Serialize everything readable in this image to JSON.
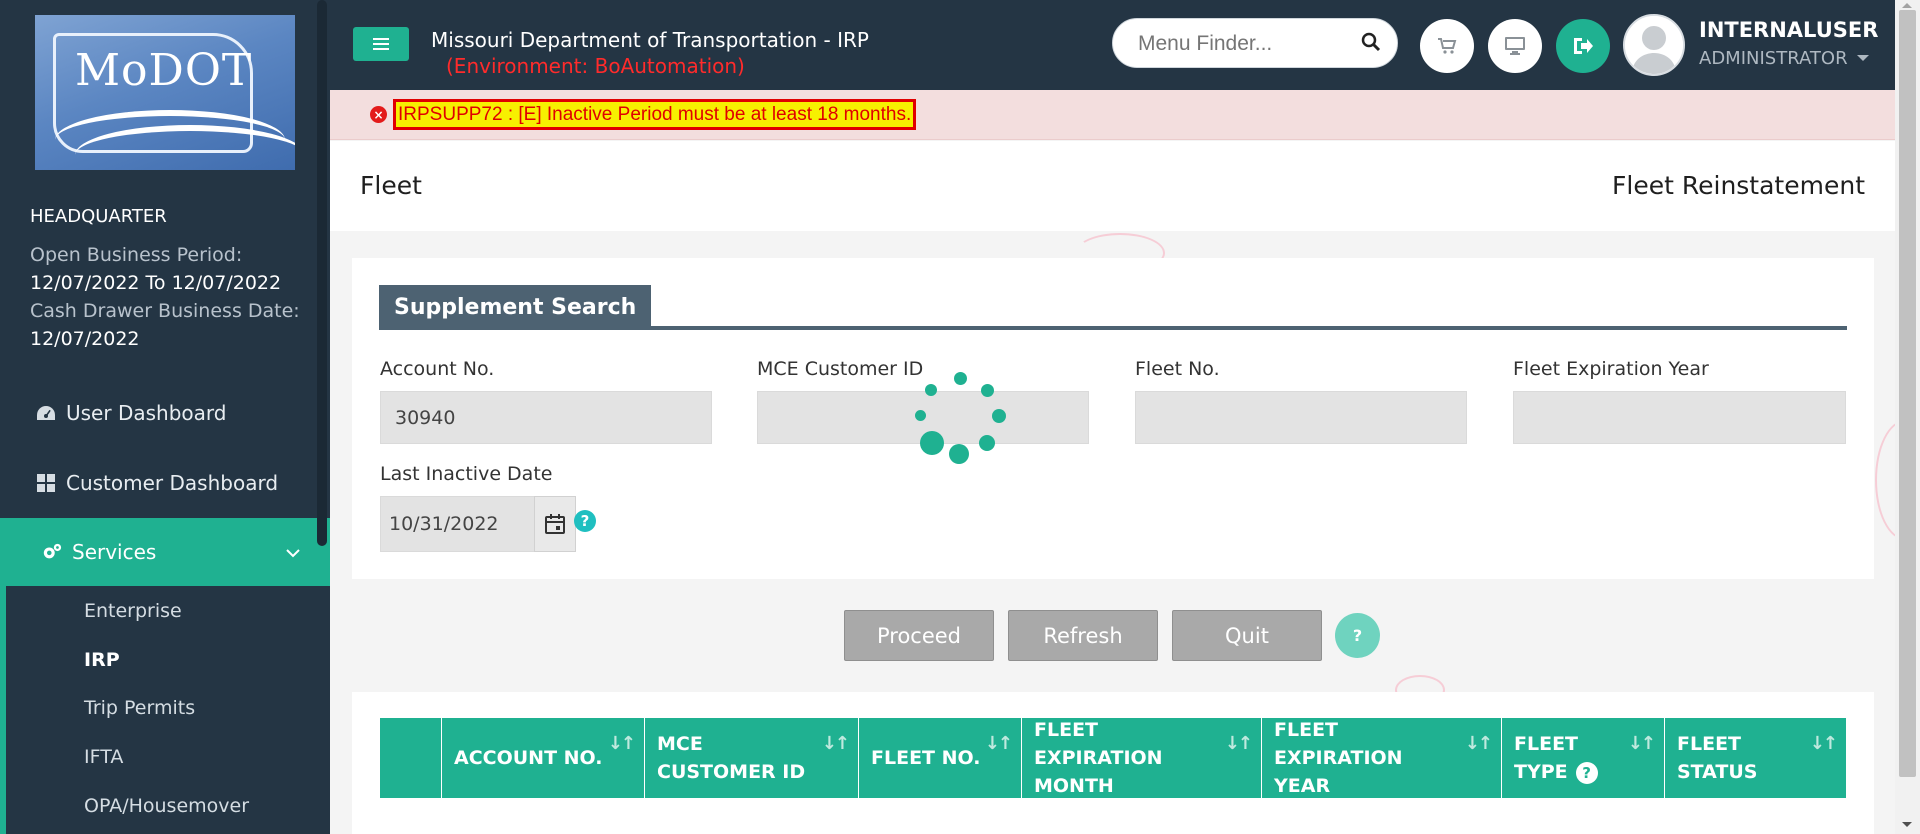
{
  "sidebar": {
    "logo_text": "MoDOT",
    "location": "HEADQUARTER",
    "open_period_label": "Open Business Period:",
    "open_period_value": "12/07/2022 To 12/07/2022",
    "cash_drawer_label": "Cash Drawer Business Date:",
    "cash_drawer_value": "12/07/2022",
    "nav": [
      {
        "label": "User Dashboard",
        "icon": "dashboard-icon"
      },
      {
        "label": "Customer Dashboard",
        "icon": "grid-icon"
      },
      {
        "label": "Services",
        "icon": "gears-icon"
      }
    ],
    "sub_items": [
      "Enterprise",
      "IRP",
      "Trip Permits",
      "IFTA",
      "OPA/Housemover"
    ]
  },
  "header": {
    "title": "Missouri Department of Transportation - IRP",
    "environment": "(Environment: BoAutomation)",
    "search_placeholder": "Menu Finder...",
    "user_name": "INTERNALUSER",
    "user_role": "ADMINISTRATOR"
  },
  "error": {
    "message": "IRPSUPP72 : [E] Inactive Period must be at least 18 months."
  },
  "page": {
    "left_title": "Fleet",
    "right_title": "Fleet Reinstatement"
  },
  "search": {
    "section_title": "Supplement Search",
    "fields": {
      "account_no": {
        "label": "Account No.",
        "value": "30940"
      },
      "mce_customer_id": {
        "label": "MCE Customer ID",
        "value": ""
      },
      "fleet_no": {
        "label": "Fleet No.",
        "value": ""
      },
      "fleet_exp_year": {
        "label": "Fleet Expiration Year",
        "value": ""
      },
      "last_inactive_date": {
        "label": "Last Inactive Date",
        "value": "10/31/2022"
      }
    }
  },
  "buttons": {
    "proceed": "Proceed",
    "refresh": "Refresh",
    "quit": "Quit"
  },
  "table": {
    "columns": [
      {
        "label": ""
      },
      {
        "label": "ACCOUNT NO."
      },
      {
        "label": "MCE CUSTOMER ID"
      },
      {
        "label": "FLEET NO."
      },
      {
        "label": "FLEET EXPIRATION MONTH"
      },
      {
        "label": "FLEET EXPIRATION YEAR"
      },
      {
        "label": "FLEET TYPE"
      },
      {
        "label": "FLEET STATUS"
      }
    ]
  },
  "colors": {
    "sidebar_bg": "#243544",
    "accent": "#1fb191",
    "error_text": "#e00000",
    "error_highlight": "#f7f000"
  }
}
